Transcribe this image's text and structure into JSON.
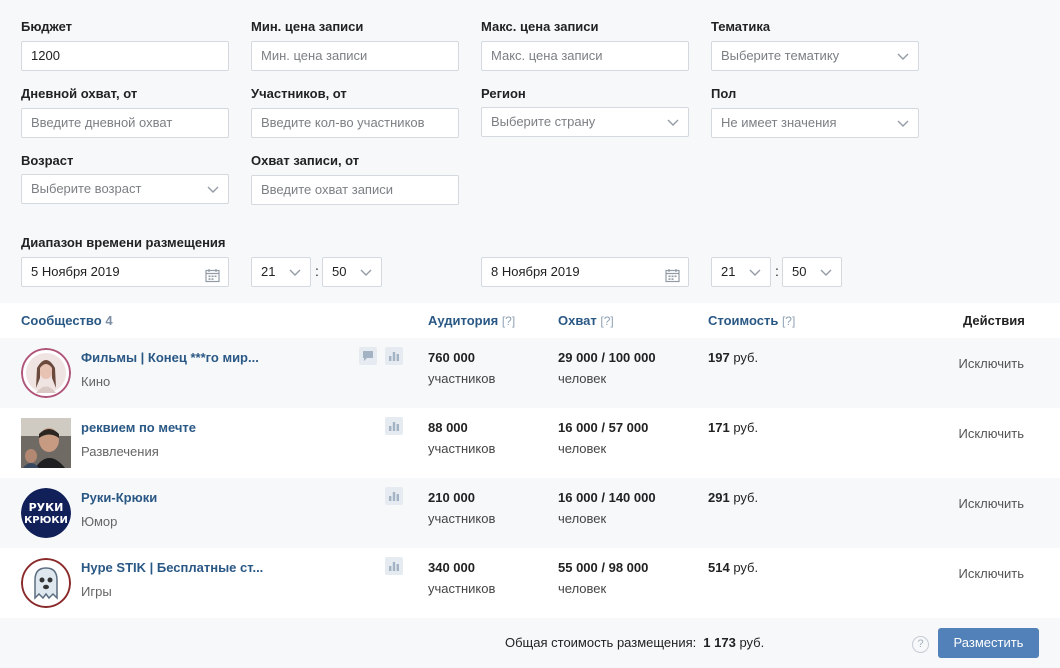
{
  "filters": {
    "budget": {
      "label": "Бюджет",
      "value": "1200"
    },
    "min_price": {
      "label": "Мин. цена записи",
      "placeholder": "Мин. цена записи"
    },
    "max_price": {
      "label": "Макс. цена записи",
      "placeholder": "Макс. цена записи"
    },
    "topic": {
      "label": "Тематика",
      "value": "Выберите тематику"
    },
    "daily_reach": {
      "label": "Дневной охват, от",
      "placeholder": "Введите дневной охват"
    },
    "members": {
      "label": "Участников, от",
      "placeholder": "Введите кол-во участников"
    },
    "region": {
      "label": "Регион",
      "value": "Выберите страну"
    },
    "gender": {
      "label": "Пол",
      "value": "Не имеет значения"
    },
    "age": {
      "label": "Возраст",
      "value": "Выберите возраст"
    },
    "post_reach": {
      "label": "Охват записи, от",
      "placeholder": "Введите охват записи"
    },
    "time_range": {
      "label": "Диапазон времени размещения",
      "start_date": "5 Ноября 2019",
      "start_hour": "21",
      "start_minute": "50",
      "end_date": "8 Ноября 2019",
      "end_hour": "21",
      "end_minute": "50",
      "separator": ":"
    }
  },
  "table": {
    "headers": {
      "community": "Сообщество",
      "community_count": "4",
      "audience": "Аудитория",
      "reach": "Охват",
      "cost": "Стоимость",
      "help_mark": "[?]",
      "actions": "Действия"
    },
    "rows": [
      {
        "name": "Фильмы | Конец ***го мир...",
        "category": "Кино",
        "audience": "760 000",
        "audience_unit": "участников",
        "reach": "29 000 / 100 000",
        "reach_unit": "человек",
        "cost": "197",
        "currency": "руб.",
        "action": "Исключить"
      },
      {
        "name": "реквием по мечте",
        "category": "Развлечения",
        "audience": "88 000",
        "audience_unit": "участников",
        "reach": "16 000 / 57 000",
        "reach_unit": "человек",
        "cost": "171",
        "currency": "руб.",
        "action": "Исключить"
      },
      {
        "name": "Руки-Крюки",
        "category": "Юмор",
        "audience": "210 000",
        "audience_unit": "участников",
        "reach": "16 000 / 140 000",
        "reach_unit": "человек",
        "cost": "291",
        "currency": "руб.",
        "action": "Исключить",
        "avatar_text_1": "РУКИ",
        "avatar_text_2": "КРЮКИ"
      },
      {
        "name": "Hype STIK | Бесплатные ст...",
        "category": "Игры",
        "audience": "340 000",
        "audience_unit": "участников",
        "reach": "55 000 / 98 000",
        "reach_unit": "человек",
        "cost": "514",
        "currency": "руб.",
        "action": "Исключить"
      }
    ]
  },
  "footer": {
    "total_label": "Общая стоимость размещения:",
    "total_value": "1 173",
    "currency": "руб.",
    "help": "?",
    "submit_label": "Разместить"
  },
  "colors": {
    "accent": "#5181b8",
    "link": "#2a5885",
    "panel": "#f7f8fa",
    "border": "#d3d9de"
  }
}
